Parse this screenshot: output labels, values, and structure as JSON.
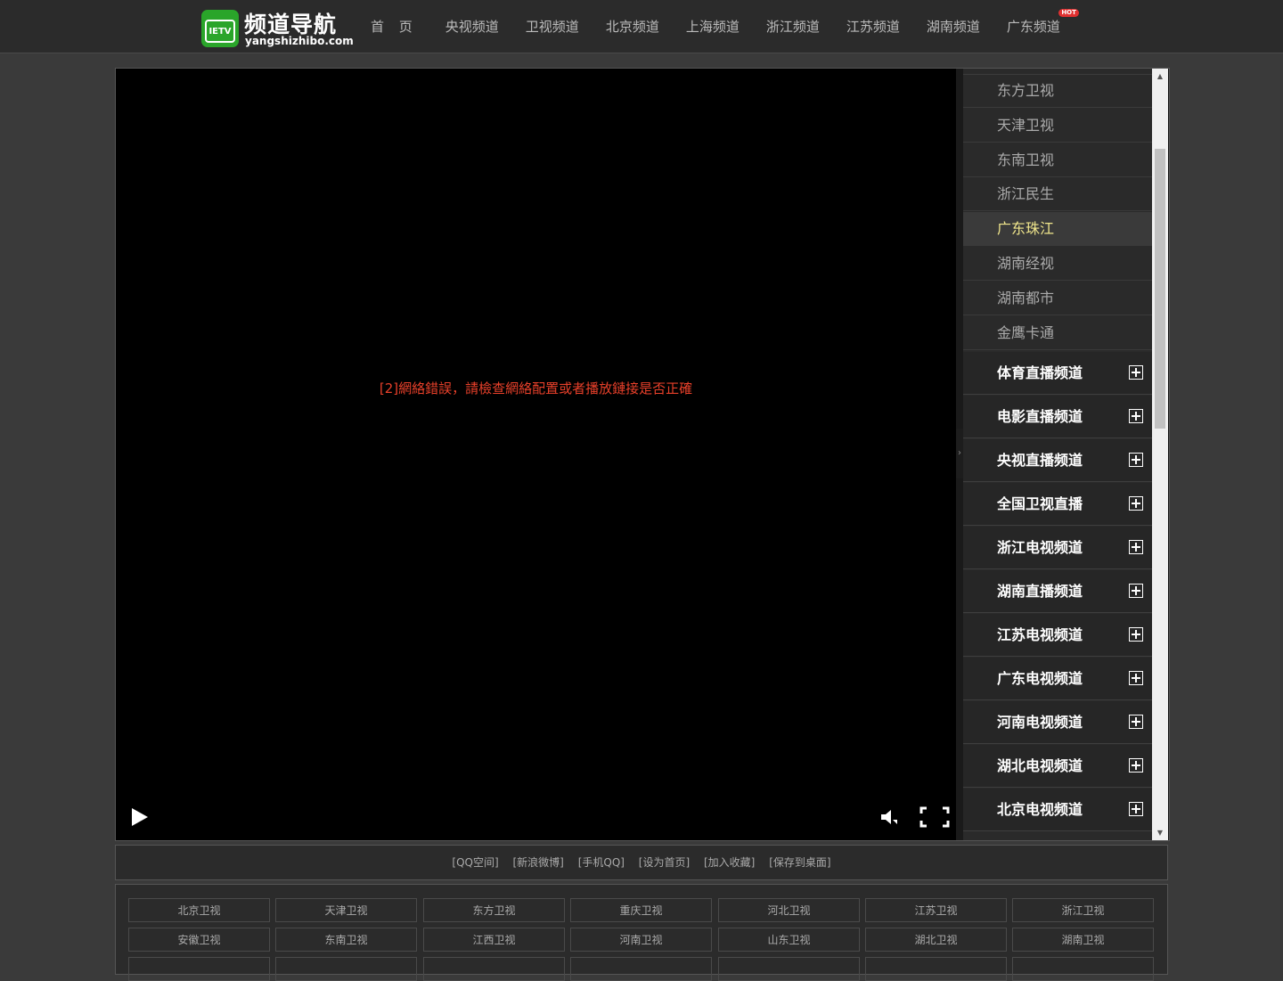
{
  "header": {
    "logo_title": "频道导航",
    "logo_sub": "yangshizhibo.com",
    "logo_badge": "IETV",
    "nav": [
      "首 页",
      "央视频道",
      "卫视频道",
      "北京频道",
      "上海频道",
      "浙江频道",
      "江苏频道",
      "湖南频道",
      "广东频道"
    ],
    "hot_label": "HOT"
  },
  "player": {
    "error_text": "[2]網絡錯誤，請檢查網絡配置或者播放鏈接是否正確",
    "collapse_glyph": "›"
  },
  "sidebar": {
    "channels": [
      "东方卫视",
      "天津卫视",
      "东南卫视",
      "浙江民生",
      "广东珠江",
      "湖南经视",
      "湖南都市",
      "金鹰卡通"
    ],
    "active_channel": "广东珠江",
    "groups": [
      "体育直播频道",
      "电影直播频道",
      "央视直播频道",
      "全国卫视直播",
      "浙江电视频道",
      "湖南直播频道",
      "江苏电视频道",
      "广东电视频道",
      "河南电视频道",
      "湖北电视频道",
      "北京电视频道"
    ]
  },
  "scrollbar": {
    "up": "▲",
    "down": "▼"
  },
  "share": [
    "[QQ空间]",
    "[新浪微博]",
    "[手机QQ]",
    "[设为首页]",
    "[加入收藏]",
    "[保存到桌面]"
  ],
  "grid": {
    "row1": [
      "北京卫视",
      "天津卫视",
      "东方卫视",
      "重庆卫视",
      "河北卫视",
      "江苏卫视",
      "浙江卫视"
    ],
    "row2": [
      "安徽卫视",
      "东南卫视",
      "江西卫视",
      "河南卫视",
      "山东卫视",
      "湖北卫视",
      "湖南卫视"
    ]
  },
  "colors": {
    "accent_active": "#f0e68c",
    "error": "#e8402a",
    "hot": "#e03030",
    "logo_green": "#2aa52a"
  }
}
